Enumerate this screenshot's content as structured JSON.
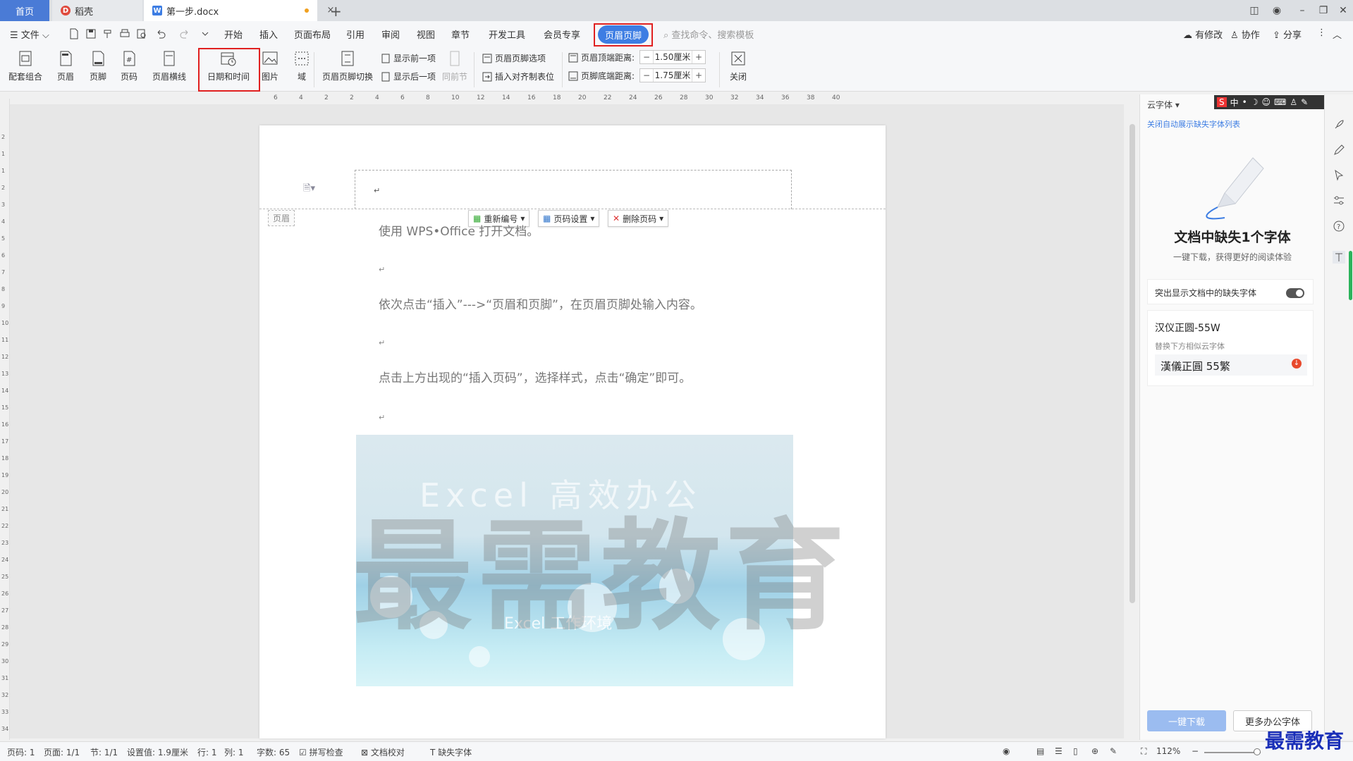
{
  "tabs": {
    "home": "首页",
    "draft": "稻壳",
    "document": "第一步.docx"
  },
  "menu": {
    "file": "文件",
    "items": [
      "开始",
      "插入",
      "页面布局",
      "引用",
      "审阅",
      "视图",
      "章节",
      "开发工具",
      "会员专享"
    ],
    "active": "页眉页脚",
    "search": "查找命令、搜索模板",
    "right": {
      "modify": "有修改",
      "collab": "协作",
      "share": "分享"
    }
  },
  "ribbon": {
    "combo": "配套组合",
    "header": "页眉",
    "footer": "页脚",
    "page_number": "页码",
    "header_line": "页眉横线",
    "date_time": "日期和时间",
    "picture": "图片",
    "field": "域",
    "switch": "页眉页脚切换",
    "prev": "显示前一项",
    "next": "显示后一项",
    "same_prev": "同前节",
    "options": "页眉页脚选项",
    "align_tab": "插入对齐制表位",
    "header_dist_label": "页眉顶端距离:",
    "header_dist_value": "1.50厘米",
    "footer_dist_label": "页脚底端距离:",
    "footer_dist_value": "1.75厘米",
    "close": "关闭"
  },
  "ruler_top": [
    "6",
    "4",
    "2",
    "2",
    "4",
    "6",
    "8",
    "10",
    "12",
    "14",
    "16",
    "18",
    "20",
    "22",
    "24",
    "26",
    "28",
    "30",
    "32",
    "34",
    "36",
    "38",
    "40"
  ],
  "ruler_left": [
    "2",
    "1",
    "1",
    "2",
    "3",
    "4",
    "5",
    "6",
    "7",
    "8",
    "9",
    "10",
    "11",
    "12",
    "13",
    "14",
    "15",
    "16",
    "17",
    "18",
    "19",
    "20",
    "21",
    "22",
    "23",
    "24",
    "25",
    "26",
    "27",
    "28",
    "29",
    "30",
    "31",
    "32",
    "33",
    "34"
  ],
  "document": {
    "header_tag": "页眉",
    "tools": {
      "renumber": "重新编号",
      "page_setup": "页码设置",
      "delete": "删除页码"
    },
    "paragraphs": [
      "使用 WPS•Office 打开文档。",
      "依次点击“插入”--->“页眉和页脚”，在页眉页脚处输入内容。",
      "点击上方出现的“插入页码”，选择样式，点击“确定”即可。"
    ],
    "image_text_top": "Excel 高效办公",
    "image_text_bottom": "Excel 工作环境",
    "watermark": "最需教育"
  },
  "panel": {
    "title": "云字体",
    "link": "关闭自动展示缺失字体列表",
    "heading": "文档中缺失1个字体",
    "sub": "一键下载，获得更好的阅读体验",
    "toggle_label": "突出显示文档中的缺失字体",
    "font_name": "汉仪正圆-55W",
    "replace_hint": "替换下方相似云字体",
    "alt_font": "漢儀正圓 55繁",
    "download": "一键下载",
    "more": "更多办公字体"
  },
  "status": {
    "page": "页码: 1",
    "pages": "页面: 1/1",
    "section": "节: 1/1",
    "setting": "设置值: 1.9厘米",
    "row": "行: 1",
    "col": "列: 1",
    "words": "字数: 65",
    "spell": "拼写检查",
    "proof": "文档校对",
    "missing": "缺失字体",
    "zoom": "112%"
  },
  "brand": "最需教育",
  "colors": {
    "accent": "#3d7de3",
    "highlight": "#e02020",
    "brand": "#1a2fb8"
  }
}
